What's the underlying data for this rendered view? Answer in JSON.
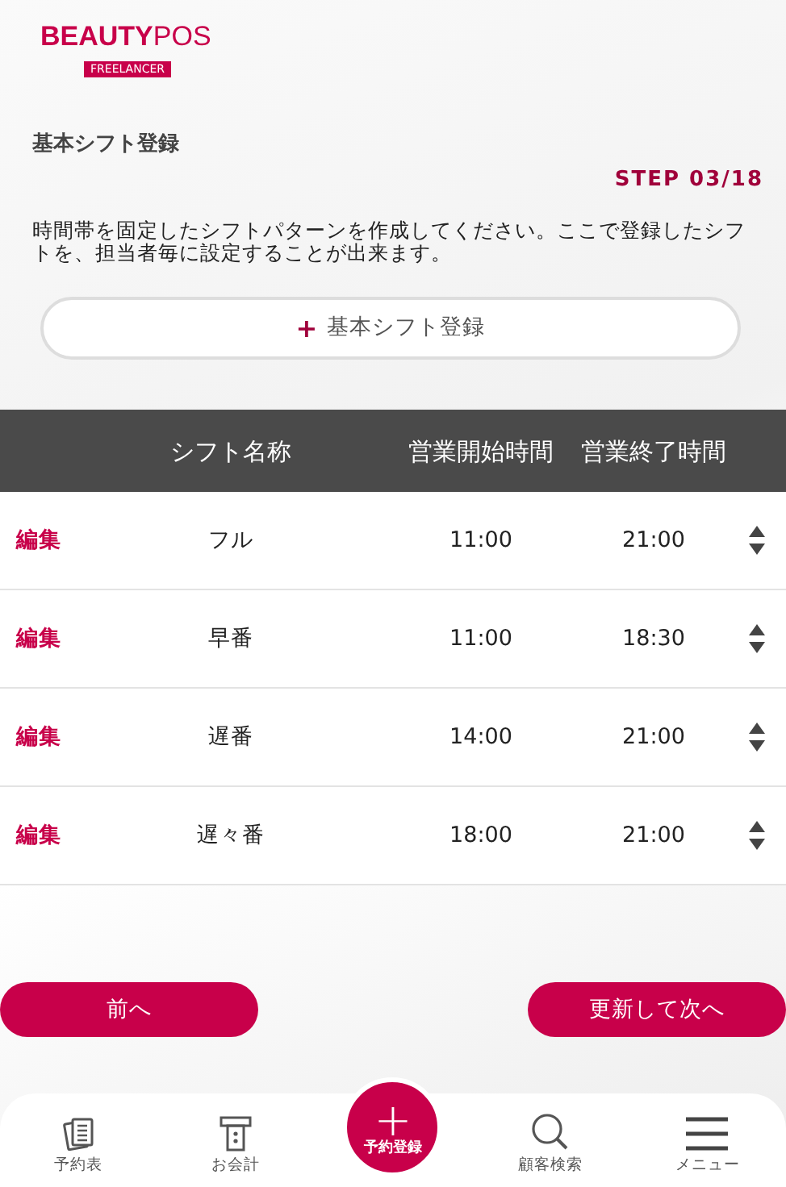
{
  "logo": {
    "brand_bold": "BEAUTY",
    "brand_light": "POS",
    "sub": "FREELANCER"
  },
  "title": "基本シフト登録",
  "step": "STEP 03/18",
  "description": "時間帯を固定したシフトパターンを作成してください。ここで登録したシフトを、担当者毎に設定することが出来ます。",
  "add_button": {
    "icon": "+",
    "label": "基本シフト登録"
  },
  "table": {
    "columns": [
      "シフト名称",
      "営業開始時間",
      "営業終了時間"
    ],
    "rows": [
      {
        "edit": "編集",
        "name": "フル",
        "start": "11:00",
        "end": "21:00"
      },
      {
        "edit": "編集",
        "name": "早番",
        "start": "11:00",
        "end": "18:30"
      },
      {
        "edit": "編集",
        "name": "遅番",
        "start": "14:00",
        "end": "21:00"
      },
      {
        "edit": "編集",
        "name": "遅々番",
        "start": "18:00",
        "end": "21:00"
      }
    ]
  },
  "buttons": {
    "prev": "前へ",
    "next": "更新して次へ"
  },
  "nav": [
    {
      "kind": "schedule",
      "label": "予約表"
    },
    {
      "kind": "register",
      "label": "お会計"
    },
    {
      "kind": "reserve",
      "icon": "+",
      "label": "予約登録"
    },
    {
      "kind": "search",
      "label": "顧客検索"
    },
    {
      "kind": "menu",
      "label": "メニュー"
    }
  ]
}
